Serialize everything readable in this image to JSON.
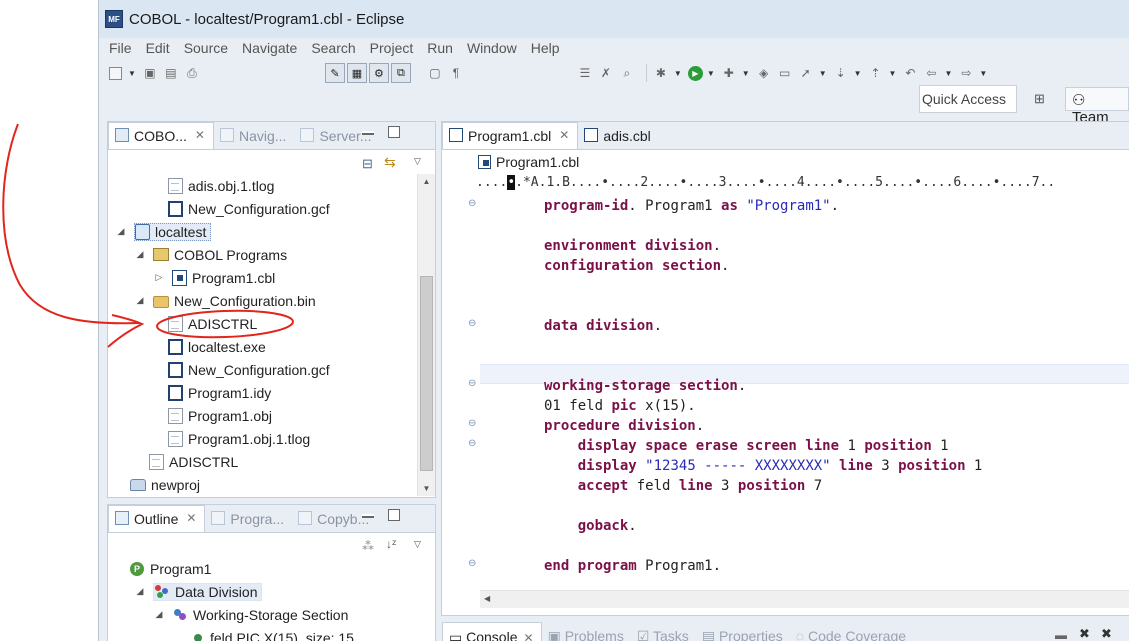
{
  "window": {
    "title": "COBOL - localtest/Program1.cbl - Eclipse",
    "app_icon_label": "MF"
  },
  "menu": [
    "File",
    "Edit",
    "Source",
    "Navigate",
    "Search",
    "Project",
    "Run",
    "Window",
    "Help"
  ],
  "toolbar": {
    "quick_access": "Quick Access",
    "perspective_label": "Team"
  },
  "explorer": {
    "tabs": [
      "COBO...",
      "Navig...",
      "Server..."
    ],
    "rows": [
      {
        "label": "adis.obj.1.tlog",
        "icon": "file-icon"
      },
      {
        "label": "New_Configuration.gcf",
        "icon": "config-file-icon"
      },
      {
        "label": "localtest",
        "icon": "project-icon"
      },
      {
        "label": "COBOL Programs",
        "icon": "cobol-folder-icon"
      },
      {
        "label": "Program1.cbl",
        "icon": "cobol-file-icon"
      },
      {
        "label": "New_Configuration.bin",
        "icon": "folder-icon"
      },
      {
        "label": "ADISCTRL",
        "icon": "file-icon"
      },
      {
        "label": "localtest.exe",
        "icon": "config-file-icon"
      },
      {
        "label": "New_Configuration.gcf",
        "icon": "config-file-icon"
      },
      {
        "label": "Program1.idy",
        "icon": "config-file-icon"
      },
      {
        "label": "Program1.obj",
        "icon": "file-icon"
      },
      {
        "label": "Program1.obj.1.tlog",
        "icon": "file-icon"
      },
      {
        "label": "ADISCTRL",
        "icon": "file-icon"
      },
      {
        "label": "newproj",
        "icon": "project-icon"
      }
    ]
  },
  "outline": {
    "tabs": [
      "Outline",
      "Progra...",
      "Copyb..."
    ],
    "rows": [
      {
        "label": "Program1",
        "icon": "program-icon"
      },
      {
        "label": "Data Division",
        "icon": "division-icon"
      },
      {
        "label": "Working-Storage Section",
        "icon": "section-icon"
      },
      {
        "label": "feld PIC X(15), size: 15",
        "icon": "field-icon"
      }
    ]
  },
  "editor": {
    "tabs": [
      "Program1.cbl",
      "adis.cbl"
    ],
    "breadcrumb": "Program1.cbl",
    "ruler": "....•.*A.1.B....•....2....•....3....•....4....•....5....•....6....•....7..",
    "lines": [
      {
        "parts": [
          [
            "kw",
            "program-id"
          ],
          [
            "",
            "."
          ],
          [
            "",
            " Program1 "
          ],
          [
            "kw",
            "as"
          ],
          [
            "",
            " "
          ],
          [
            "str",
            "\"Program1\""
          ],
          [
            "",
            "."
          ]
        ]
      },
      {
        "parts": []
      },
      {
        "parts": [
          [
            "kw",
            "environment division"
          ],
          [
            "",
            "."
          ]
        ]
      },
      {
        "parts": [
          [
            "kw",
            "configuration section"
          ],
          [
            "",
            "."
          ]
        ]
      },
      {
        "parts": []
      },
      {
        "parts": []
      },
      {
        "parts": [
          [
            "kw",
            "data division"
          ],
          [
            "",
            "."
          ]
        ]
      },
      {
        "parts": []
      },
      {
        "parts": []
      },
      {
        "parts": [
          [
            "kw",
            "working-storage section"
          ],
          [
            "",
            "."
          ]
        ]
      },
      {
        "parts": [
          [
            "",
            "01 feld "
          ],
          [
            "kw",
            "pic"
          ],
          [
            "",
            " x(15)."
          ]
        ]
      },
      {
        "parts": [
          [
            "kw",
            "procedure division"
          ],
          [
            "",
            "."
          ]
        ]
      },
      {
        "parts": [
          [
            "",
            "    "
          ],
          [
            "kw",
            "display space erase screen line"
          ],
          [
            "",
            " 1 "
          ],
          [
            "kw",
            "position"
          ],
          [
            "",
            " 1"
          ]
        ]
      },
      {
        "parts": [
          [
            "",
            "    "
          ],
          [
            "kw",
            "display"
          ],
          [
            "",
            " "
          ],
          [
            "str",
            "\"12345 ----- XXXXXXXX\""
          ],
          [
            "",
            " "
          ],
          [
            "kw",
            "line"
          ],
          [
            "",
            " 3 "
          ],
          [
            "kw",
            "position"
          ],
          [
            "",
            " 1"
          ]
        ]
      },
      {
        "parts": [
          [
            "",
            "    "
          ],
          [
            "kw",
            "accept"
          ],
          [
            "",
            " feld "
          ],
          [
            "kw",
            "line"
          ],
          [
            "",
            " 3 "
          ],
          [
            "kw",
            "position"
          ],
          [
            "",
            " 7"
          ]
        ]
      },
      {
        "parts": []
      },
      {
        "parts": [
          [
            "",
            "    "
          ],
          [
            "kw",
            "goback"
          ],
          [
            "",
            "."
          ]
        ]
      },
      {
        "parts": []
      },
      {
        "parts": [
          [
            "kw",
            "end program"
          ],
          [
            "",
            " Program1."
          ]
        ]
      }
    ]
  },
  "console": {
    "tabs": [
      "Console",
      "Problems",
      "Tasks",
      "Properties",
      "Code Coverage"
    ]
  },
  "colors": {
    "annotation": "#e0261d",
    "keyword": "#7a1047",
    "string": "#2a2ab8",
    "chrome": "#e9eef5"
  }
}
